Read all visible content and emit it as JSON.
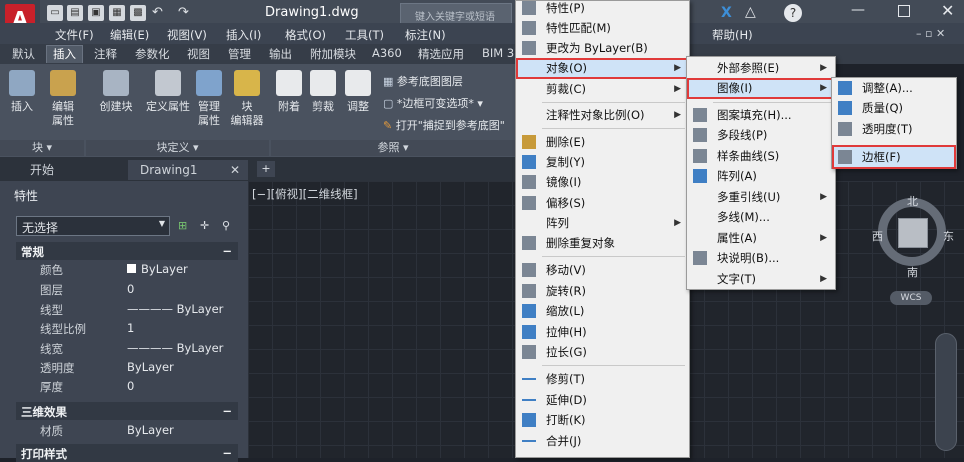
{
  "title": {
    "document": "Drawing1.dwg",
    "search_placeholder": "键入关键字或短语",
    "app_logo": "A"
  },
  "menubar": [
    "文件(F)",
    "编辑(E)",
    "视图(V)",
    "插入(I)",
    "格式(O)",
    "工具(T)",
    "标注(N)",
    "帮助(H)"
  ],
  "ribbon_tabs": [
    "默认",
    "插入",
    "注释",
    "参数化",
    "视图",
    "管理",
    "输出",
    "附加模块",
    "A360",
    "精选应用",
    "BIM 3"
  ],
  "ribbon": {
    "buttons": [
      "插入",
      "编辑\n属性",
      "创建块",
      "定义属性",
      "管理\n属性",
      "块\n编辑器",
      "附着",
      "剪裁",
      "调整"
    ],
    "ref_items": [
      "参考底图图层",
      "*边框可变选项*",
      "打开\"捕捉到参考底图\""
    ],
    "groups": [
      "块 ▾",
      "块定义 ▾",
      "参照 ▾"
    ]
  },
  "doc_tabs": [
    "开始",
    "Drawing1"
  ],
  "palette": {
    "title": "特性",
    "selection": "无选择",
    "sections": [
      {
        "name": "常规",
        "rows": [
          [
            "颜色",
            "ByLayer"
          ],
          [
            "图层",
            "0"
          ],
          [
            "线型",
            "———— ByLayer"
          ],
          [
            "线型比例",
            "1"
          ],
          [
            "线宽",
            "———— ByLayer"
          ],
          [
            "透明度",
            "ByLayer"
          ],
          [
            "厚度",
            "0"
          ]
        ]
      },
      {
        "name": "三维效果",
        "rows": [
          [
            "材质",
            "ByLayer"
          ]
        ]
      },
      {
        "name": "打印样式",
        "rows": []
      }
    ]
  },
  "view_label": "[−][俯视][二维线框]",
  "viewcube": {
    "north": "北",
    "south": "南",
    "east": "东",
    "west": "西",
    "wcs": "WCS"
  },
  "modify_menu": [
    "特性(P)",
    "特性匹配(M)",
    "更改为 ByLayer(B)",
    "对象(O)",
    "剪裁(C)",
    "注释性对象比例(O)",
    "删除(E)",
    "复制(Y)",
    "镜像(I)",
    "偏移(S)",
    "阵列",
    "删除重复对象",
    "移动(V)",
    "旋转(R)",
    "缩放(L)",
    "拉伸(H)",
    "拉长(G)",
    "修剪(T)",
    "延伸(D)",
    "打断(K)",
    "合并(J)"
  ],
  "object_menu": [
    "外部参照(E)",
    "图像(I)",
    "图案填充(H)...",
    "多段线(P)",
    "样条曲线(S)",
    "阵列(A)",
    "多重引线(U)",
    "多线(M)...",
    "属性(A)",
    "块说明(B)...",
    "文字(T)"
  ],
  "image_menu": [
    "调整(A)...",
    "质量(Q)",
    "透明度(T)",
    "边框(F)"
  ],
  "colors": {
    "highlight": "#cfe3f7",
    "red_outline": "#e03a3a",
    "app_red": "#c8202a"
  }
}
